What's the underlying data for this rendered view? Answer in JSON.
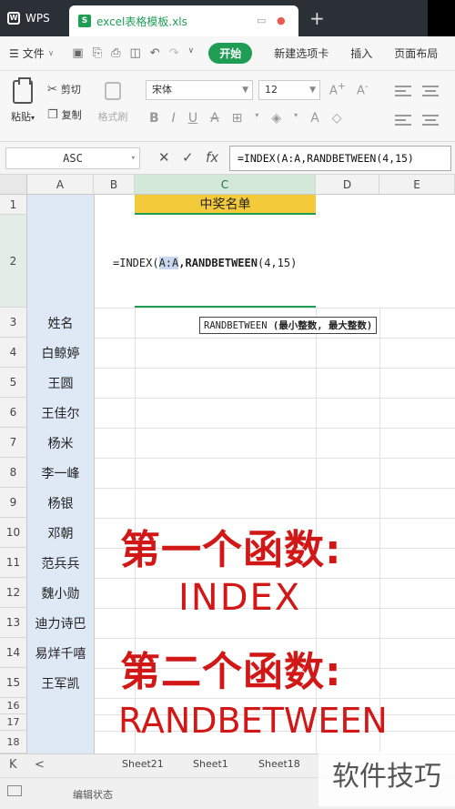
{
  "titlebar": {
    "app_name": "WPS",
    "document_tab": "excel表格模板.xls"
  },
  "menubar": {
    "file_label": "文件",
    "start_label": "开始",
    "items": [
      "新建选项卡",
      "插入",
      "页面布局"
    ]
  },
  "ribbon": {
    "paste_label": "粘贴",
    "cut_label": "剪切",
    "copy_label": "复制",
    "format_painter_label": "格式刷",
    "font_name": "宋体",
    "font_size": "12"
  },
  "formulabar": {
    "name_box": "ASC",
    "formula": "=INDEX(A:A,RANDBETWEEN(4,15)"
  },
  "grid": {
    "columns": [
      "A",
      "B",
      "C",
      "D",
      "E"
    ],
    "rows": [
      "1",
      "2",
      "3",
      "4",
      "5",
      "6",
      "7",
      "8",
      "9",
      "10",
      "11",
      "12",
      "13",
      "14",
      "15",
      "16",
      "17",
      "18"
    ],
    "c1": "中奖名单",
    "c2_prefix": "=INDEX(",
    "c2_ref": "A:A",
    "c2_func": ",RANDBETWEEN",
    "c2_suffix": "(4,15)",
    "tooltip_func": "RANDBETWEEN",
    "tooltip_args": "(最小整数, 最大整数)",
    "names": [
      "姓名",
      "白鲸婷",
      "王圆",
      "王佳尔",
      "杨米",
      "李一峰",
      "杨银",
      "邓朝",
      "范兵兵",
      "魏小勋",
      "迪力诗巴",
      "易烊千嘻",
      "王军凯"
    ]
  },
  "overlay": {
    "line1": "第一个函数:",
    "line2": "INDEX",
    "line3": "第二个函数:",
    "line4": "RANDBETWEEN"
  },
  "sheets": [
    "Sheet21",
    "Sheet1",
    "Sheet18"
  ],
  "status": "编辑状态",
  "watermark": "软件技巧"
}
